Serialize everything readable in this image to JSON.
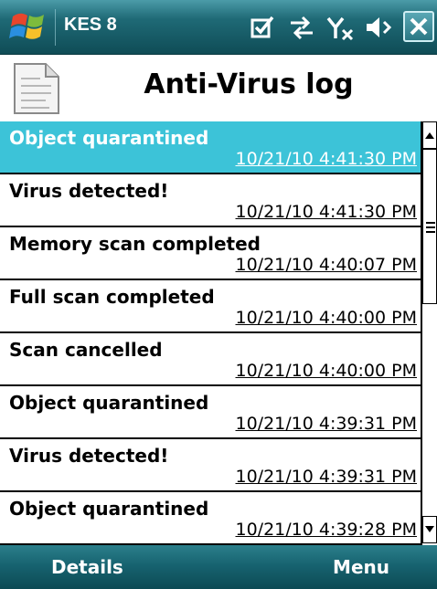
{
  "status_bar": {
    "app_name": "KES 8",
    "icons": [
      "windows-start-icon",
      "checkbox-icon",
      "connectivity-icon",
      "no-signal-icon",
      "speaker-muted-icon",
      "close-icon"
    ]
  },
  "header": {
    "title": "Anti-Virus log",
    "icon": "document-icon"
  },
  "log_entries": [
    {
      "event": "Object quarantined",
      "time": "10/21/10 4:41:30 PM",
      "selected": true
    },
    {
      "event": "Virus detected!",
      "time": "10/21/10 4:41:30 PM",
      "selected": false
    },
    {
      "event": "Memory scan completed",
      "time": "10/21/10 4:40:07 PM",
      "selected": false
    },
    {
      "event": "Full scan completed",
      "time": "10/21/10 4:40:00 PM",
      "selected": false
    },
    {
      "event": "Scan cancelled",
      "time": "10/21/10 4:40:00 PM",
      "selected": false
    },
    {
      "event": "Object quarantined",
      "time": "10/21/10 4:39:31 PM",
      "selected": false
    },
    {
      "event": "Virus detected!",
      "time": "10/21/10 4:39:31 PM",
      "selected": false
    },
    {
      "event": "Object quarantined",
      "time": "10/21/10 4:39:28 PM",
      "selected": false
    }
  ],
  "softkeys": {
    "left": "Details",
    "right": "Menu"
  },
  "colors": {
    "selection": "#3cc3d8",
    "bar_dark": "#0f4c56",
    "bar_light": "#4b9ba8"
  }
}
